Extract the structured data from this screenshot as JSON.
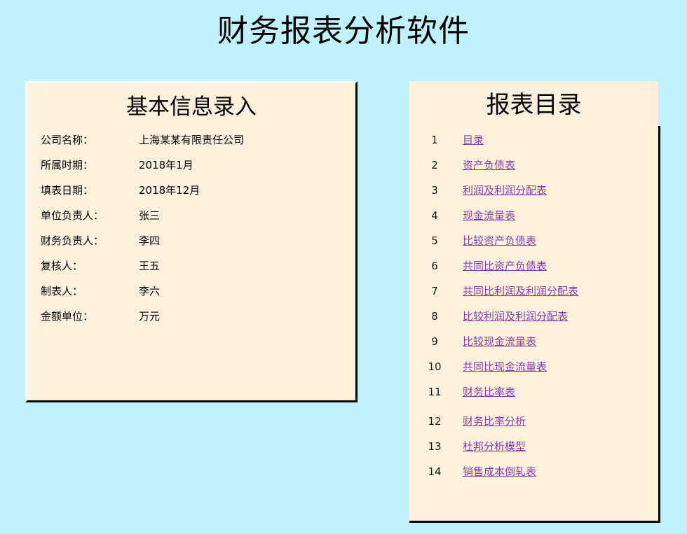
{
  "app_title": "财务报表分析软件",
  "info_panel": {
    "title": "基本信息录入",
    "fields": [
      {
        "label": "公司名称：",
        "value": "上海某某有限责任公司"
      },
      {
        "label": "所属时期：",
        "value": "2018年1月"
      },
      {
        "label": "填表日期：",
        "value": "2018年12月"
      },
      {
        "label": "单位负责人：",
        "value": "张三"
      },
      {
        "label": "财务负责人：",
        "value": "李四"
      },
      {
        "label": "复核人：",
        "value": "王五"
      },
      {
        "label": "制表人：",
        "value": "李六"
      },
      {
        "label": "金额单位：",
        "value": "万元"
      }
    ]
  },
  "toc_panel": {
    "title": "报表目录",
    "items": [
      {
        "num": "1",
        "label": "目录"
      },
      {
        "num": "2",
        "label": "资产负债表"
      },
      {
        "num": "3",
        "label": "利润及利润分配表"
      },
      {
        "num": "4",
        "label": "现金流量表"
      },
      {
        "num": "5",
        "label": "比较资产负债表"
      },
      {
        "num": "6",
        "label": "共同比资产负债表"
      },
      {
        "num": "7",
        "label": "共同比利润及利润分配表"
      },
      {
        "num": "8",
        "label": "比较利润及利润分配表"
      },
      {
        "num": "9",
        "label": "比较现金流量表"
      },
      {
        "num": "10",
        "label": "共同比现金流量表"
      },
      {
        "num": "11",
        "label": "财务比率表"
      },
      {
        "num": "12",
        "label": "财务比率分析"
      },
      {
        "num": "13",
        "label": "杜邦分析模型"
      },
      {
        "num": "14",
        "label": "销售成本倒轧表"
      }
    ]
  },
  "colors": {
    "background": "#bff2f9",
    "panel": "#fdf1de",
    "link": "#8a3fa6"
  }
}
